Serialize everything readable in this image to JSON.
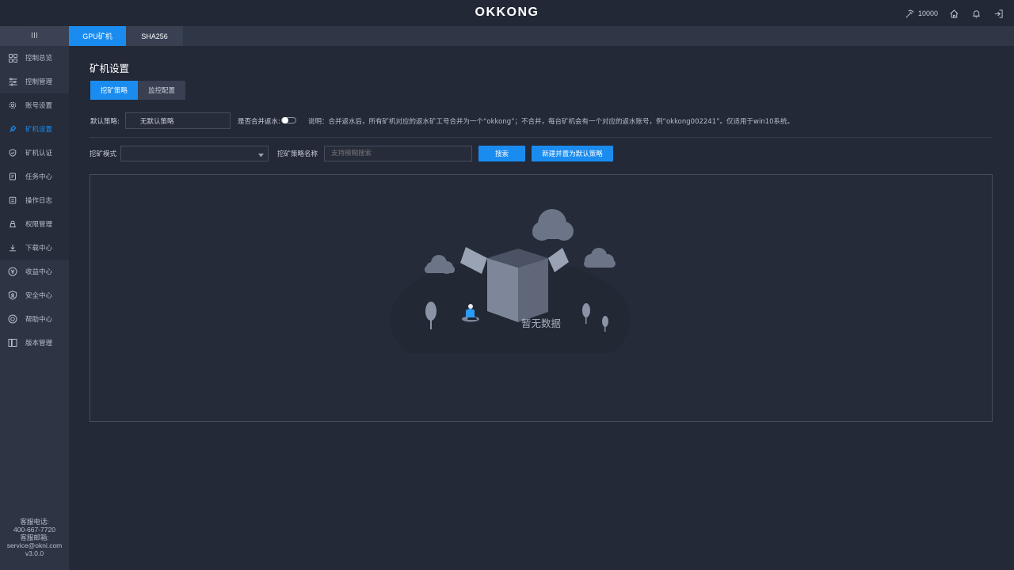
{
  "app": {
    "logo": "OKKONG"
  },
  "header": {
    "power_count": "10000"
  },
  "tabs": [
    {
      "label": "GPU矿机"
    },
    {
      "label": "SHA256"
    }
  ],
  "sidebar": {
    "items": [
      {
        "label": "控制总览",
        "icon": "grid-icon"
      },
      {
        "label": "控制管理",
        "icon": "sliders-icon"
      },
      {
        "label": "账号设置",
        "icon": "gear-icon"
      },
      {
        "label": "矿机设置",
        "icon": "wrench-icon"
      },
      {
        "label": "矿机认证",
        "icon": "shield-check-icon"
      },
      {
        "label": "任务中心",
        "icon": "task-icon"
      },
      {
        "label": "操作日志",
        "icon": "log-icon"
      },
      {
        "label": "权限管理",
        "icon": "user-lock-icon"
      },
      {
        "label": "下载中心",
        "icon": "download-icon"
      },
      {
        "label": "收益中心",
        "icon": "coin-icon"
      },
      {
        "label": "安全中心",
        "icon": "lock-icon"
      },
      {
        "label": "帮助中心",
        "icon": "lifebuoy-icon"
      },
      {
        "label": "版本管理",
        "icon": "book-icon"
      }
    ],
    "footer": {
      "phone_label": "客服电话:",
      "phone": "400-667-7720",
      "email_label": "客服邮箱:",
      "email": "service@okni.com",
      "version": "v3.0.0"
    }
  },
  "main": {
    "title": "矿机设置",
    "sub_tabs": [
      {
        "label": "挖矿策略"
      },
      {
        "label": "监控配置"
      }
    ],
    "default_strategy_label": "默认策略:",
    "default_strategy_value": "无默认策略",
    "merge_label": "是否合并返水:",
    "merge_enabled": false,
    "note": "说明：合并返水后，所有矿机对应的返水矿工号合并为一个“okkong”；不合并，每台矿机会有一个对应的返水账号，例“okkong002241”。仅适用于win10系统。",
    "mode_label": "挖矿模式",
    "mode_value": "",
    "strategy_name_label": "挖矿策略名称",
    "strategy_name_placeholder": "支持模糊搜索",
    "search_button": "搜索",
    "create_button": "新建并置为默认策略",
    "empty_text": "暂无数据"
  }
}
